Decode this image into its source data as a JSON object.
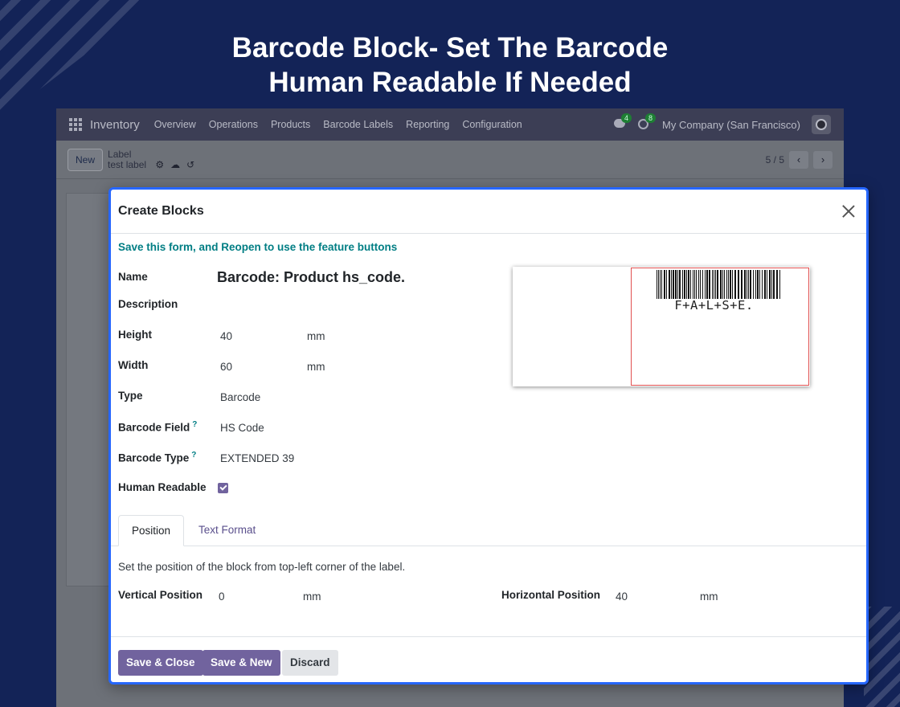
{
  "headline": {
    "line1": "Barcode Block- Set The Barcode",
    "line2": "Human Readable If Needed"
  },
  "app": {
    "name": "Inventory",
    "menu": [
      "Overview",
      "Operations",
      "Products",
      "Barcode Labels",
      "Reporting",
      "Configuration"
    ],
    "messages_badge": "4",
    "activities_badge": "8",
    "company": "My Company (San Francisco)",
    "new_button": "New",
    "breadcrumb_parent": "Label",
    "breadcrumb_current": "test label",
    "pager": "5 / 5"
  },
  "modal": {
    "title": "Create Blocks",
    "notice": "Save this form, and Reopen to use the feature buttons",
    "fields": {
      "name": {
        "label": "Name",
        "value": "Barcode: Product hs_code."
      },
      "description": {
        "label": "Description"
      },
      "height": {
        "label": "Height",
        "value": "40",
        "unit": "mm"
      },
      "width": {
        "label": "Width",
        "value": "60",
        "unit": "mm"
      },
      "type": {
        "label": "Type",
        "value": "Barcode"
      },
      "barcode_field": {
        "label": "Barcode Field",
        "help": "?",
        "value": "HS Code"
      },
      "barcode_type": {
        "label": "Barcode Type",
        "help": "?",
        "value": "EXTENDED 39"
      },
      "human_readable": {
        "label": "Human Readable",
        "checked": true
      }
    },
    "preview": {
      "human_readable_text": "F+A+L+S+E."
    },
    "tabs": [
      "Position",
      "Text Format"
    ],
    "active_tab": "Position",
    "position": {
      "description": "Set the position of the block from top-left corner of the label.",
      "vertical": {
        "label": "Vertical Position",
        "value": "0",
        "unit": "mm"
      },
      "horizontal": {
        "label": "Horizontal Position",
        "value": "40",
        "unit": "mm"
      }
    },
    "buttons": {
      "save_close": "Save & Close",
      "save_new": "Save & New",
      "discard": "Discard"
    }
  },
  "colors": {
    "background": "#132357",
    "primary": "#71639e",
    "accent_teal": "#017e84",
    "modal_border": "#2667ff"
  }
}
